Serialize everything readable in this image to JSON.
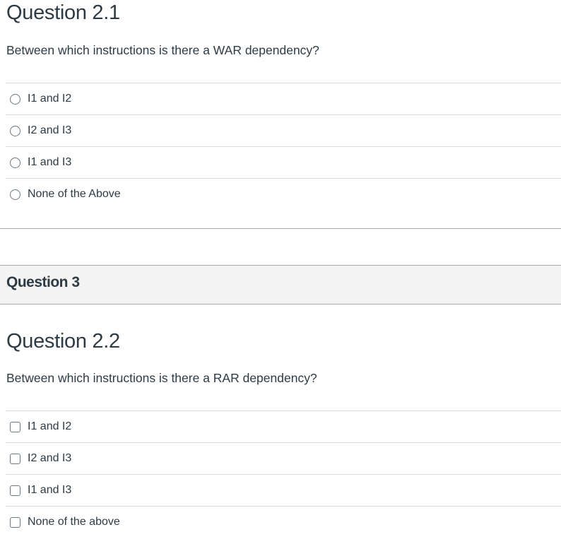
{
  "question_2_1": {
    "title": "Question 2.1",
    "text": "Between which instructions is there a WAR dependency?",
    "type": "radio",
    "options": [
      "I1 and I2",
      "I2 and I3",
      "I1 and I3",
      "None of the Above"
    ]
  },
  "question_3_header": {
    "title": "Question 3"
  },
  "question_2_2": {
    "title": "Question 2.2",
    "text": "Between which instructions is there a RAR dependency?",
    "type": "checkbox",
    "options": [
      "I1 and I2",
      "I2 and I3",
      "I1 and I3",
      "None of the above"
    ]
  }
}
